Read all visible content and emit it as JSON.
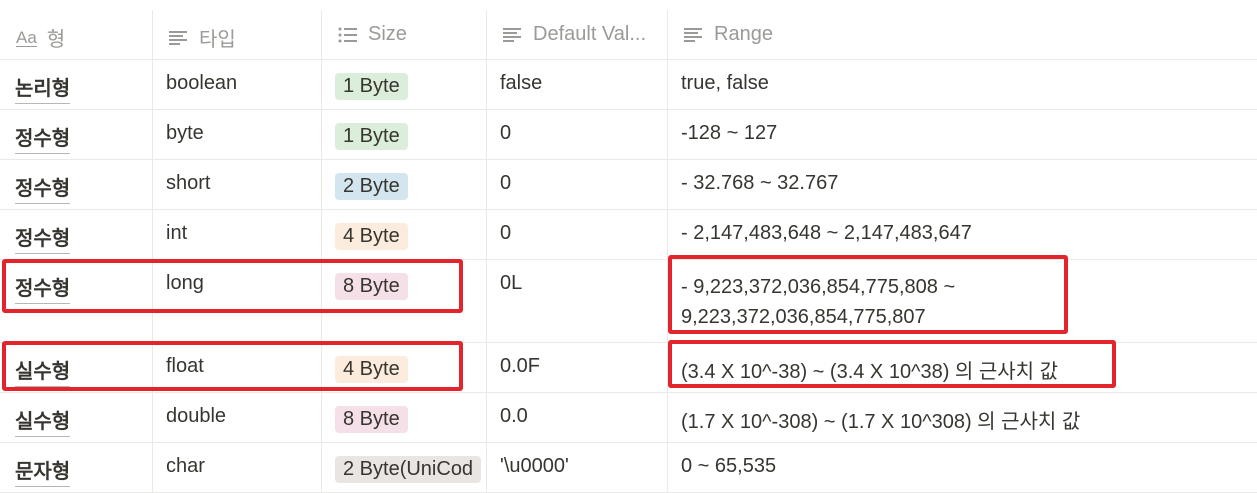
{
  "header": {
    "col1": "형",
    "col2": "타입",
    "col3": "Size",
    "col4": "Default Val...",
    "col5": "Range"
  },
  "rows": [
    {
      "kind": "논리형",
      "type": "boolean",
      "size": "1 Byte",
      "size_color": "#dbeddb",
      "default": "false",
      "range": "true, false"
    },
    {
      "kind": "정수형",
      "type": "byte",
      "size": "1 Byte",
      "size_color": "#dbeddb",
      "default": "0",
      "range": "-128 ~ 127"
    },
    {
      "kind": "정수형",
      "type": "short",
      "size": "2 Byte",
      "size_color": "#d3e5ef",
      "default": "0",
      "range": "- 32.768 ~ 32.767"
    },
    {
      "kind": "정수형",
      "type": "int",
      "size": "4 Byte",
      "size_color": "#fbecdd",
      "default": "0",
      "range": "- 2,147,483,648 ~ 2,147,483,647"
    },
    {
      "kind": "정수형",
      "type": "long",
      "size": "8 Byte",
      "size_color": "#f5e0e9",
      "default": "0L",
      "range_line1": "- 9,223,372,036,854,775,808 ~",
      "range_line2": "9,223,372,036,854,775,807"
    },
    {
      "kind": "실수형",
      "type": "float",
      "size": "4 Byte",
      "size_color": "#fbecdd",
      "default": "0.0F",
      "range": "(3.4 X 10^-38) ~ (3.4 X 10^38) 의 근사치 값"
    },
    {
      "kind": "실수형",
      "type": "double",
      "size": "8 Byte",
      "size_color": "#f5e0e9",
      "default": "0.0",
      "range": "(1.7 X 10^-308) ~ (1.7 X 10^308) 의 근사치 값"
    },
    {
      "kind": "문자형",
      "type": "char",
      "size": "2 Byte(UniCod",
      "size_color": "#e9e5e3",
      "default": "'\\u0000'",
      "range": "0 ~ 65,535"
    }
  ],
  "highlight_color": "#e3242b"
}
